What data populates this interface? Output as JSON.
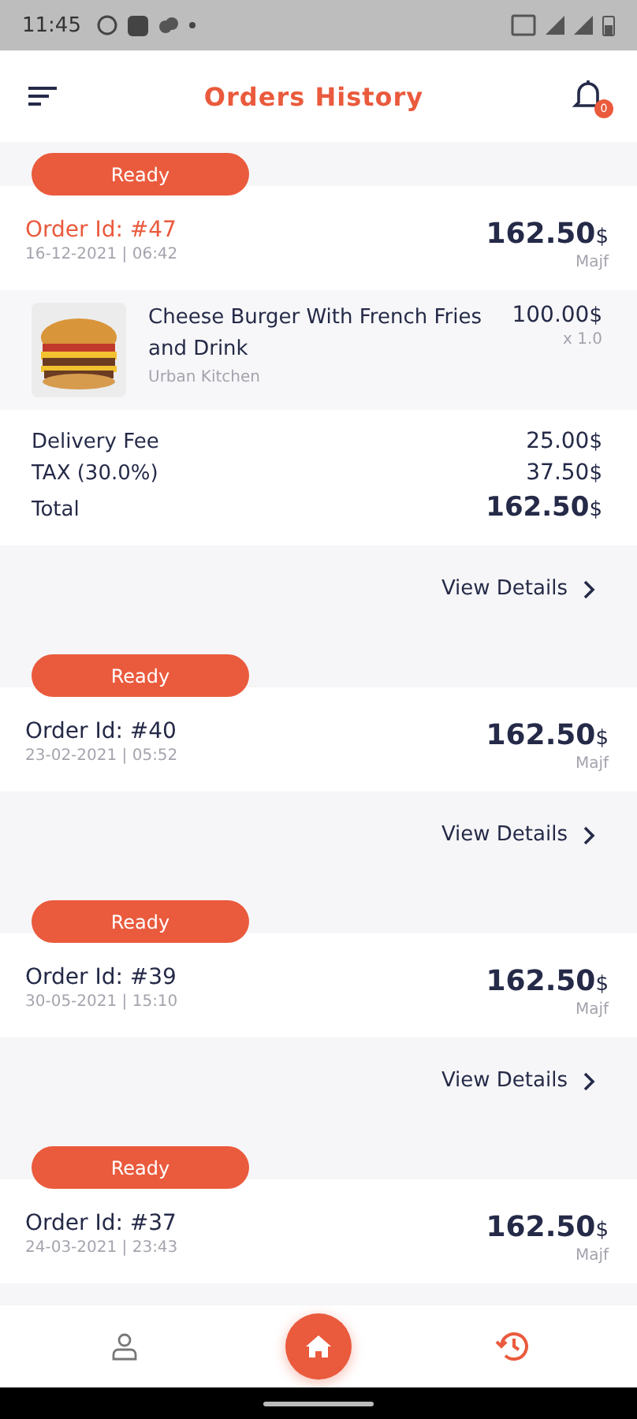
{
  "status_bar": {
    "time": "11:45"
  },
  "header": {
    "title": "Orders History",
    "notification_count": "0"
  },
  "orders": [
    {
      "status": "Ready",
      "order_id": "Order Id: #47",
      "date": "16-12-2021 | 06:42",
      "total": "162.50",
      "currency": "$",
      "customer": "Majf",
      "expanded": true,
      "items": [
        {
          "kind": "picture",
          "name": "Cheese Burger With French Fries and Drink",
          "restaurant": "Urban Kitchen",
          "price": "100.00",
          "currency": "$",
          "quantity": "x 1.0"
        }
      ],
      "fees": [
        {
          "label": "Delivery Fee",
          "amount": "25.00",
          "currency": "$"
        },
        {
          "label": "TAX (30.0%)",
          "amount": "37.50",
          "currency": "$"
        }
      ],
      "total_row": {
        "label": "Total",
        "amount": "162.50",
        "currency": "$"
      },
      "view_details": "View Details"
    },
    {
      "status": "Ready",
      "order_id": "Order Id: #40",
      "date": "23-02-2021 | 05:52",
      "total": "162.50",
      "currency": "$",
      "customer": "Majf",
      "expanded": false,
      "view_details": "View Details"
    },
    {
      "status": "Ready",
      "order_id": "Order Id: #39",
      "date": "30-05-2021 | 15:10",
      "total": "162.50",
      "currency": "$",
      "customer": "Majf",
      "expanded": false,
      "view_details": "View Details"
    },
    {
      "status": "Ready",
      "order_id": "Order Id: #37",
      "date": "24-03-2021 | 23:43",
      "total": "162.50",
      "currency": "$",
      "customer": "Majf",
      "expanded": false
    }
  ],
  "bottom_nav": [
    {
      "kind": "profile",
      "selected": false
    },
    {
      "kind": "home",
      "selected": false
    },
    {
      "kind": "history",
      "selected": true
    }
  ]
}
